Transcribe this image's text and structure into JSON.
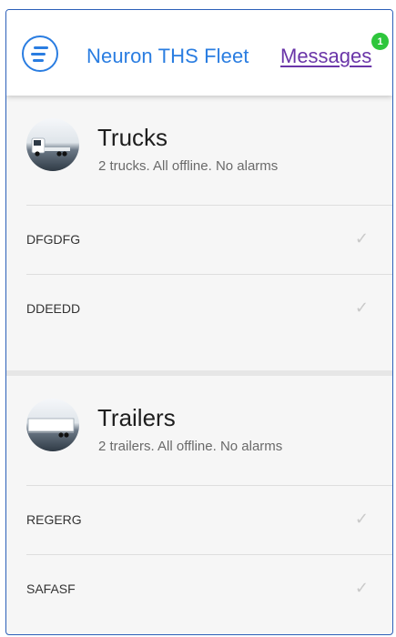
{
  "header": {
    "title": "Neuron THS Fleet",
    "messages_label": "Messages",
    "messages_count": "1"
  },
  "sections": [
    {
      "title": "Trucks",
      "subtitle": "2 trucks. All offline. No alarms",
      "icon": "truck-icon",
      "items": [
        {
          "label": "DFGDFG",
          "status_icon": "check-icon"
        },
        {
          "label": "DDEEDD",
          "status_icon": "check-icon"
        }
      ]
    },
    {
      "title": "Trailers",
      "subtitle": "2 trailers. All offline. No alarms",
      "icon": "trailer-icon",
      "items": [
        {
          "label": "REGERG",
          "status_icon": "check-icon"
        },
        {
          "label": "SAFASF",
          "status_icon": "check-icon"
        }
      ]
    }
  ],
  "colors": {
    "brand": "#2a7de1",
    "link": "#6a35a8",
    "badge": "#2ec63c",
    "frame_border": "#2b5fb8"
  }
}
